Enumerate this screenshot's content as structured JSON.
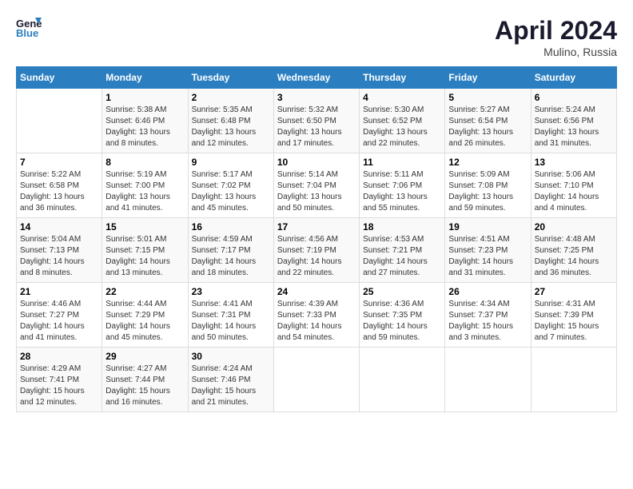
{
  "header": {
    "logo_line1": "General",
    "logo_line2": "Blue",
    "month_year": "April 2024",
    "location": "Mulino, Russia"
  },
  "weekdays": [
    "Sunday",
    "Monday",
    "Tuesday",
    "Wednesday",
    "Thursday",
    "Friday",
    "Saturday"
  ],
  "weeks": [
    [
      null,
      {
        "day": 1,
        "sunrise": "5:38 AM",
        "sunset": "6:46 PM",
        "daylight": "13 hours and 8 minutes."
      },
      {
        "day": 2,
        "sunrise": "5:35 AM",
        "sunset": "6:48 PM",
        "daylight": "13 hours and 12 minutes."
      },
      {
        "day": 3,
        "sunrise": "5:32 AM",
        "sunset": "6:50 PM",
        "daylight": "13 hours and 17 minutes."
      },
      {
        "day": 4,
        "sunrise": "5:30 AM",
        "sunset": "6:52 PM",
        "daylight": "13 hours and 22 minutes."
      },
      {
        "day": 5,
        "sunrise": "5:27 AM",
        "sunset": "6:54 PM",
        "daylight": "13 hours and 26 minutes."
      },
      {
        "day": 6,
        "sunrise": "5:24 AM",
        "sunset": "6:56 PM",
        "daylight": "13 hours and 31 minutes."
      }
    ],
    [
      {
        "day": 7,
        "sunrise": "5:22 AM",
        "sunset": "6:58 PM",
        "daylight": "13 hours and 36 minutes."
      },
      {
        "day": 8,
        "sunrise": "5:19 AM",
        "sunset": "7:00 PM",
        "daylight": "13 hours and 41 minutes."
      },
      {
        "day": 9,
        "sunrise": "5:17 AM",
        "sunset": "7:02 PM",
        "daylight": "13 hours and 45 minutes."
      },
      {
        "day": 10,
        "sunrise": "5:14 AM",
        "sunset": "7:04 PM",
        "daylight": "13 hours and 50 minutes."
      },
      {
        "day": 11,
        "sunrise": "5:11 AM",
        "sunset": "7:06 PM",
        "daylight": "13 hours and 55 minutes."
      },
      {
        "day": 12,
        "sunrise": "5:09 AM",
        "sunset": "7:08 PM",
        "daylight": "13 hours and 59 minutes."
      },
      {
        "day": 13,
        "sunrise": "5:06 AM",
        "sunset": "7:10 PM",
        "daylight": "14 hours and 4 minutes."
      }
    ],
    [
      {
        "day": 14,
        "sunrise": "5:04 AM",
        "sunset": "7:13 PM",
        "daylight": "14 hours and 8 minutes."
      },
      {
        "day": 15,
        "sunrise": "5:01 AM",
        "sunset": "7:15 PM",
        "daylight": "14 hours and 13 minutes."
      },
      {
        "day": 16,
        "sunrise": "4:59 AM",
        "sunset": "7:17 PM",
        "daylight": "14 hours and 18 minutes."
      },
      {
        "day": 17,
        "sunrise": "4:56 AM",
        "sunset": "7:19 PM",
        "daylight": "14 hours and 22 minutes."
      },
      {
        "day": 18,
        "sunrise": "4:53 AM",
        "sunset": "7:21 PM",
        "daylight": "14 hours and 27 minutes."
      },
      {
        "day": 19,
        "sunrise": "4:51 AM",
        "sunset": "7:23 PM",
        "daylight": "14 hours and 31 minutes."
      },
      {
        "day": 20,
        "sunrise": "4:48 AM",
        "sunset": "7:25 PM",
        "daylight": "14 hours and 36 minutes."
      }
    ],
    [
      {
        "day": 21,
        "sunrise": "4:46 AM",
        "sunset": "7:27 PM",
        "daylight": "14 hours and 41 minutes."
      },
      {
        "day": 22,
        "sunrise": "4:44 AM",
        "sunset": "7:29 PM",
        "daylight": "14 hours and 45 minutes."
      },
      {
        "day": 23,
        "sunrise": "4:41 AM",
        "sunset": "7:31 PM",
        "daylight": "14 hours and 50 minutes."
      },
      {
        "day": 24,
        "sunrise": "4:39 AM",
        "sunset": "7:33 PM",
        "daylight": "14 hours and 54 minutes."
      },
      {
        "day": 25,
        "sunrise": "4:36 AM",
        "sunset": "7:35 PM",
        "daylight": "14 hours and 59 minutes."
      },
      {
        "day": 26,
        "sunrise": "4:34 AM",
        "sunset": "7:37 PM",
        "daylight": "15 hours and 3 minutes."
      },
      {
        "day": 27,
        "sunrise": "4:31 AM",
        "sunset": "7:39 PM",
        "daylight": "15 hours and 7 minutes."
      }
    ],
    [
      {
        "day": 28,
        "sunrise": "4:29 AM",
        "sunset": "7:41 PM",
        "daylight": "15 hours and 12 minutes."
      },
      {
        "day": 29,
        "sunrise": "4:27 AM",
        "sunset": "7:44 PM",
        "daylight": "15 hours and 16 minutes."
      },
      {
        "day": 30,
        "sunrise": "4:24 AM",
        "sunset": "7:46 PM",
        "daylight": "15 hours and 21 minutes."
      },
      null,
      null,
      null,
      null
    ]
  ]
}
